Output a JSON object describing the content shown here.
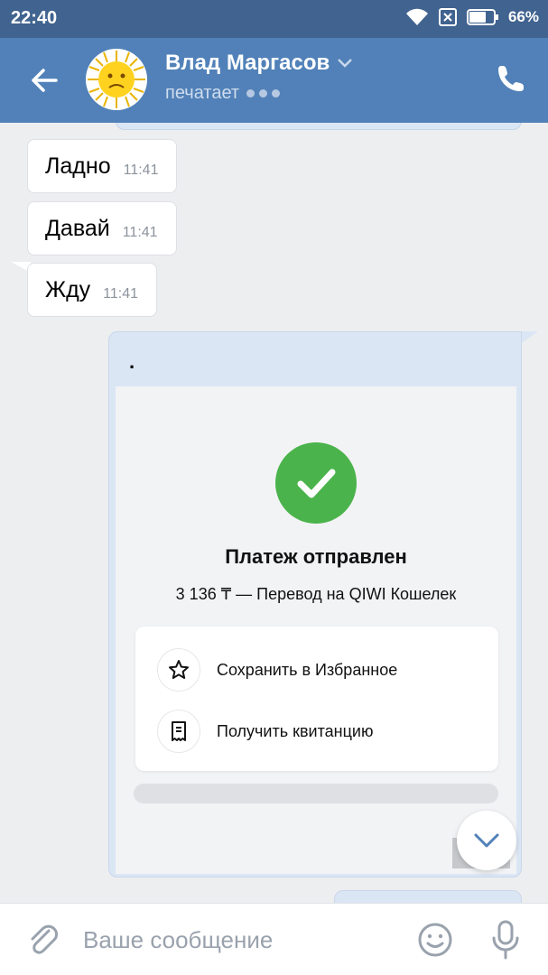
{
  "status_bar": {
    "time": "22:40",
    "battery_percent": "66%"
  },
  "header": {
    "contact_name": "Влад Маргасов",
    "contact_status": "печатает"
  },
  "messages": {
    "incoming": [
      {
        "text": "Ладно",
        "time": "11:41"
      },
      {
        "text": "Давай",
        "time": "11:41"
      },
      {
        "text": "Жду",
        "time": "11:41"
      }
    ],
    "outgoing": {
      "text": ".",
      "screenshot": {
        "title": "Платеж отправлен",
        "subtitle": "3 136 ₸ — Перевод на QIWI Кошелек",
        "options": [
          {
            "label": "Сохранить в Избранное",
            "icon": "star-icon"
          },
          {
            "label": "Получить квитанцию",
            "icon": "receipt-icon"
          }
        ]
      }
    }
  },
  "composer": {
    "placeholder": "Ваше сообщение"
  },
  "colors": {
    "header": "#5181b8",
    "status_bar": "#40638f",
    "outgoing_bubble": "#dbe6f5",
    "success_green": "#4bb34b"
  }
}
